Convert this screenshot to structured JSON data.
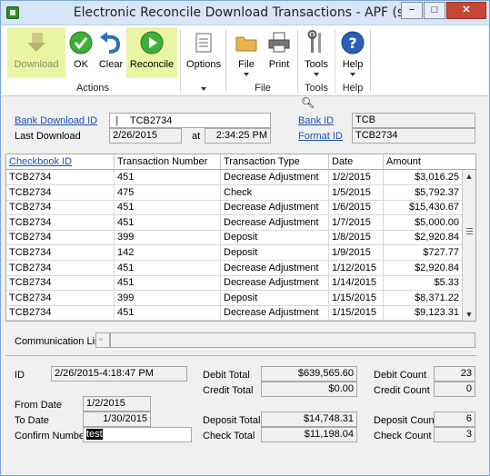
{
  "window": {
    "title": "Electronic Reconcile Download Transactions  -  APF (sa)",
    "minimize": "−",
    "restore": "□",
    "close": "✕"
  },
  "ribbon": {
    "buttons": {
      "download": "Download",
      "ok": "OK",
      "clear": "Clear",
      "reconcile": "Reconcile",
      "options": "Options",
      "file": "File",
      "print": "Print",
      "tools": "Tools",
      "help": "Help"
    },
    "groups": {
      "actions": "Actions",
      "file": "File",
      "tools": "Tools",
      "help": "Help"
    },
    "colors": {
      "highlight": "#e9f5a3",
      "ok_green": "#3fae3a",
      "help_blue": "#2d5fb5"
    }
  },
  "header": {
    "bank_download_id_label": "Bank Download ID",
    "bank_download_id_value": "TCB2734",
    "last_download_label": "Last Download",
    "last_download_date": "2/26/2015",
    "at_label": "at",
    "last_download_time": "2:34:25 PM",
    "bank_id_label": "Bank ID",
    "bank_id_value": "TCB",
    "format_id_label": "Format ID",
    "format_id_value": "TCB2734"
  },
  "grid": {
    "columns": [
      "Checkbook ID",
      "Transaction Number",
      "Transaction Type",
      "Date",
      "Amount"
    ],
    "rows": [
      [
        "TCB2734",
        "451",
        "Decrease Adjustment",
        "1/2/2015",
        "$3,016.25"
      ],
      [
        "TCB2734",
        "475",
        "Check",
        "1/5/2015",
        "$5,792.37"
      ],
      [
        "TCB2734",
        "451",
        "Decrease Adjustment",
        "1/6/2015",
        "$15,430.67"
      ],
      [
        "TCB2734",
        "451",
        "Decrease Adjustment",
        "1/7/2015",
        "$5,000.00"
      ],
      [
        "TCB2734",
        "399",
        "Deposit",
        "1/8/2015",
        "$2,920.84"
      ],
      [
        "TCB2734",
        "142",
        "Deposit",
        "1/9/2015",
        "$727.77"
      ],
      [
        "TCB2734",
        "451",
        "Decrease Adjustment",
        "1/12/2015",
        "$2,920.84"
      ],
      [
        "TCB2734",
        "451",
        "Decrease Adjustment",
        "1/14/2015",
        "$5.33"
      ],
      [
        "TCB2734",
        "399",
        "Deposit",
        "1/15/2015",
        "$8,371.22"
      ],
      [
        "TCB2734",
        "451",
        "Decrease Adjustment",
        "1/15/2015",
        "$9,123.31"
      ]
    ]
  },
  "communication_link_label": "Communication Link",
  "summary": {
    "id_label": "ID",
    "id_value": "2/26/2015-4:18:47 PM",
    "from_date_label": "From Date",
    "from_date_value": "1/2/2015",
    "to_date_label": "To Date",
    "to_date_value": "1/30/2015",
    "confirm_number_label": "Confirm Number",
    "confirm_number_value": "test",
    "debit_total_label": "Debit Total",
    "debit_total_value": "$639,565.60",
    "credit_total_label": "Credit Total",
    "credit_total_value": "$0.00",
    "deposit_total_label": "Deposit Total",
    "deposit_total_value": "$14,748.31",
    "check_total_label": "Check Total",
    "check_total_value": "$11,198.04",
    "debit_count_label": "Debit Count",
    "debit_count_value": "23",
    "credit_count_label": "Credit Count",
    "credit_count_value": "0",
    "deposit_count_label": "Deposit Count",
    "deposit_count_value": "6",
    "check_count_label": "Check Count",
    "check_count_value": "3"
  }
}
